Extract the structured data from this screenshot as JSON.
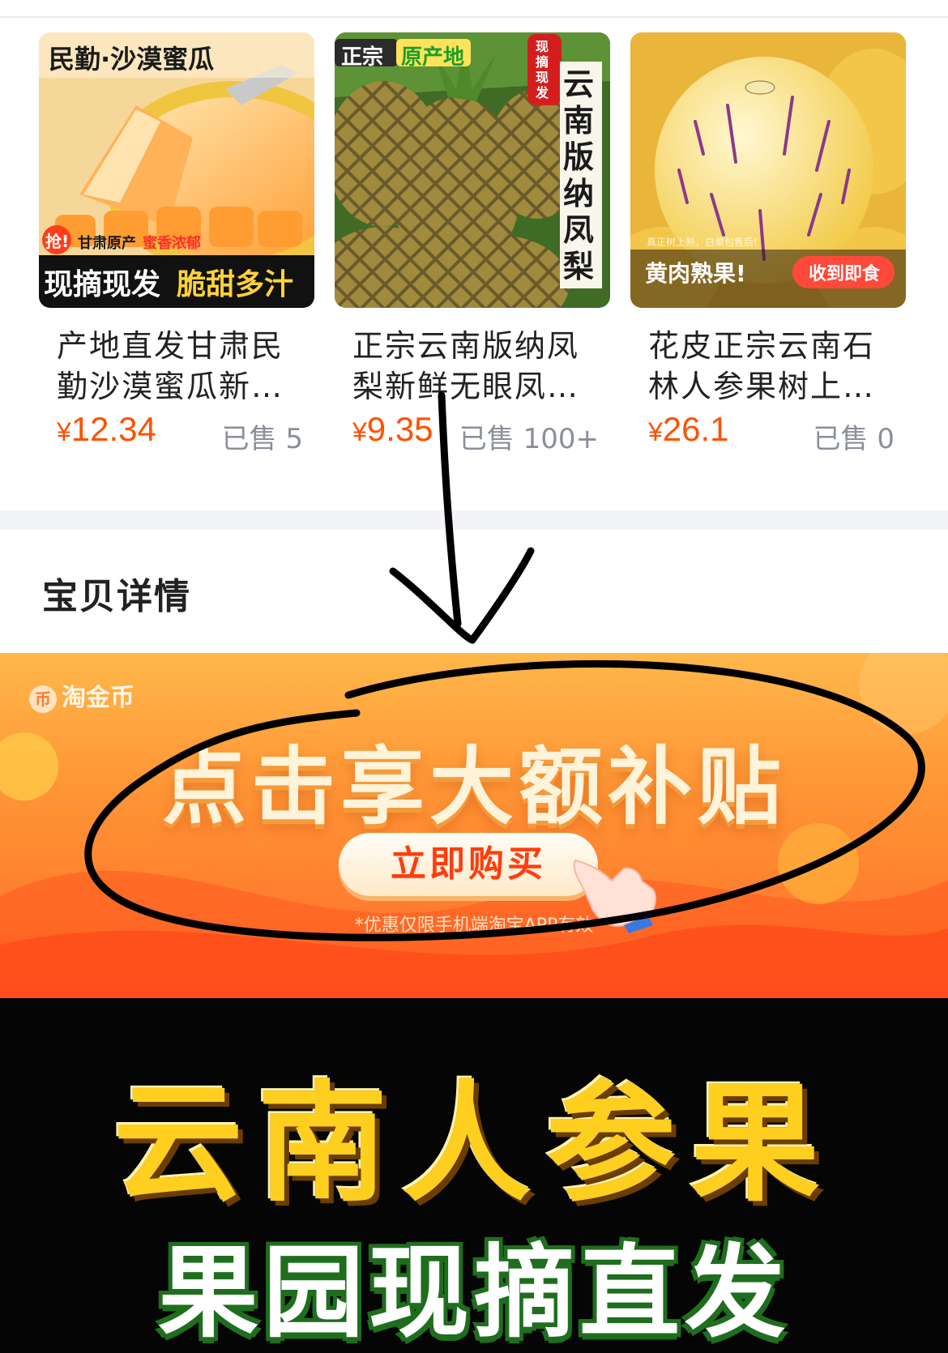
{
  "recommend": {
    "products": [
      {
        "image_labels": {
          "top": "民勤·沙漠蜜瓜",
          "badge": "抢!",
          "tag_left": "甘肃原产",
          "tag_right": "蜜香浓郁",
          "bottom_left": "现摘现发",
          "bottom_right": "脆甜多汁"
        },
        "name": "产地直发甘肃民勤沙漠蜜瓜新…",
        "currency": "¥",
        "price": "12.34",
        "sold": "已售 5"
      },
      {
        "image_labels": {
          "top_left": "正宗",
          "top_right": "原产地",
          "badge": "现摘现发",
          "side": "云南版纳凤梨"
        },
        "name": "正宗云南版纳凤梨新鲜无眼凤…",
        "currency": "¥",
        "price": "9.35",
        "sold": "已售 100+"
      },
      {
        "image_labels": {
          "small": "真正树上熟，白果包售后!",
          "left": "黄肉熟果!",
          "right": "收到即食"
        },
        "name": "花皮正宗云南石林人参果树上…",
        "currency": "¥",
        "price": "26.1",
        "sold": "已售 0"
      }
    ]
  },
  "details": {
    "title": "宝贝详情"
  },
  "banner": {
    "coin_label": "淘金币",
    "coin_glyph": "币",
    "headline": "点击享大额补贴",
    "button": "立即购买",
    "disclaimer": "*优惠仅限手机端淘宝APP有效"
  },
  "promo": {
    "title": "云南人参果",
    "subtitle": "果园现摘直发"
  },
  "colors": {
    "price": "#ff5000",
    "banner": "#ff8a30",
    "promo_title": "#ffcf1f"
  }
}
